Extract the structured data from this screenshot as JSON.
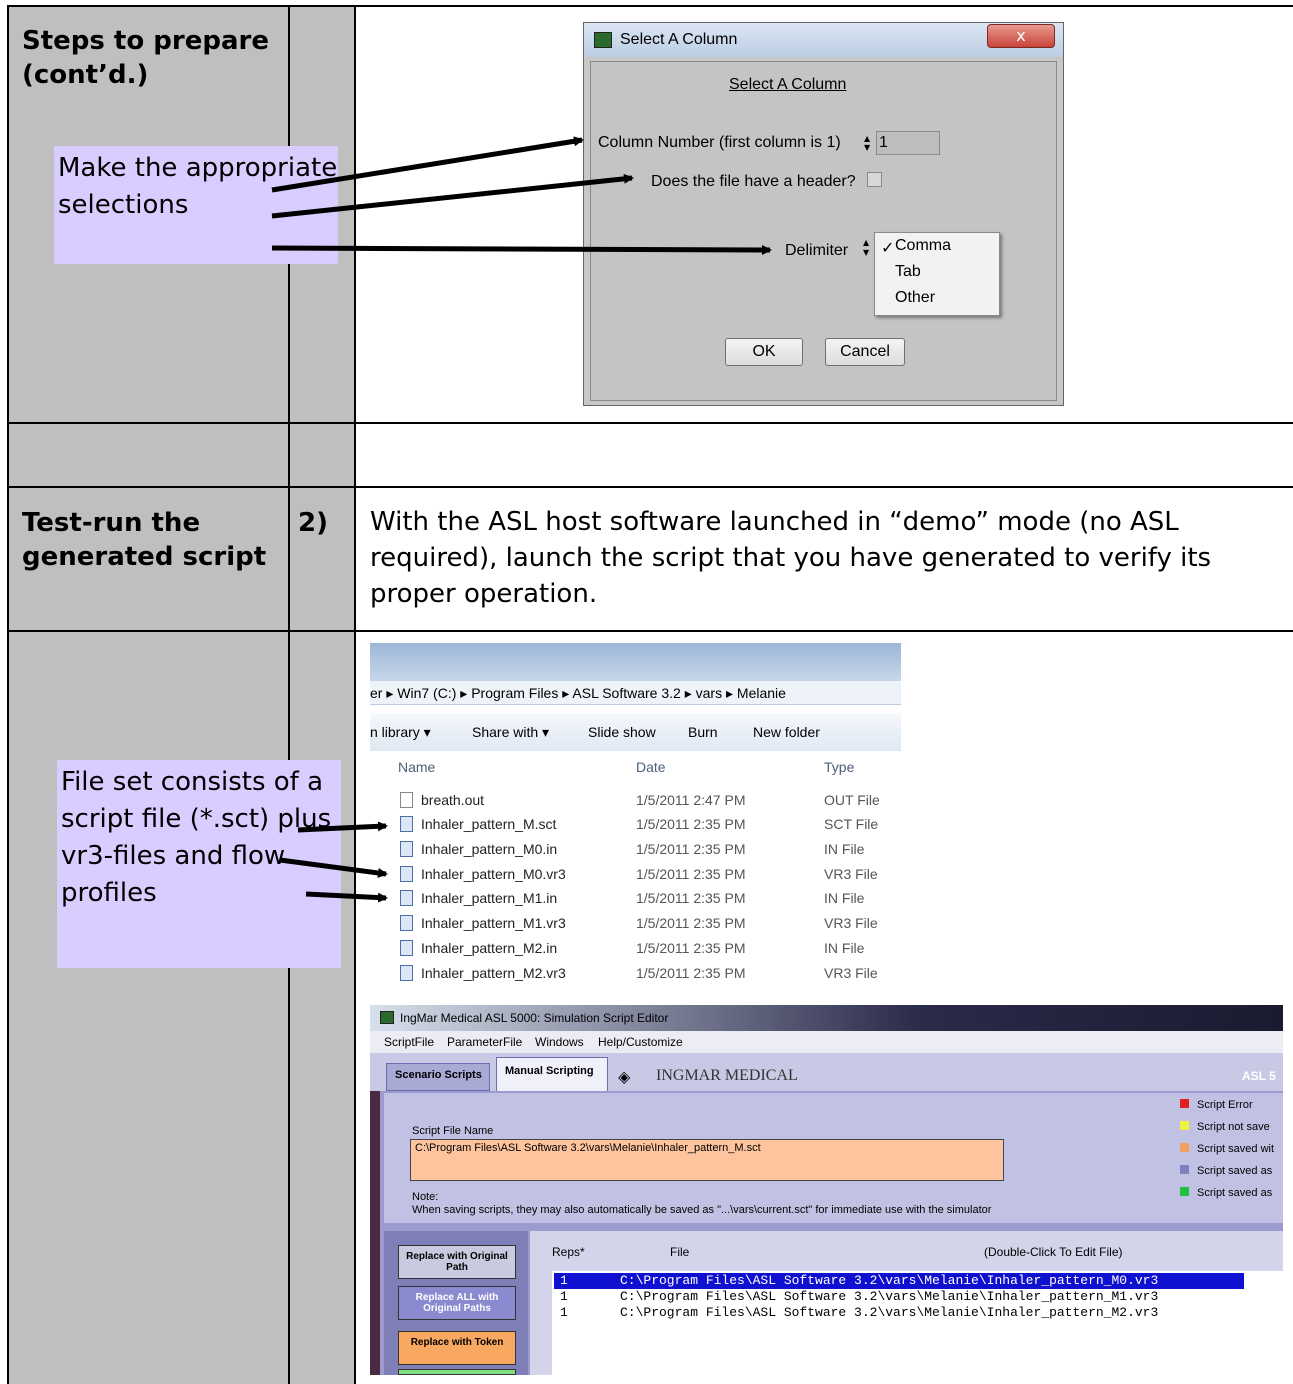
{
  "row1": {
    "heading": "Steps to prepare (cont’d.)",
    "callout": "Make the appropriate selections"
  },
  "dialog": {
    "title": "Select A Column",
    "header": "Select A Column",
    "column_label": "Column Number (first column is 1)",
    "column_value": "1",
    "header_question": "Does the file have a header?",
    "delimiter_label": "Delimiter",
    "delimiter_options": [
      "Comma",
      "Tab",
      "Other"
    ],
    "selected_mark": "✓",
    "ok": "OK",
    "cancel": "Cancel"
  },
  "row3": {
    "heading": "Test-run the generated script",
    "step": "2)",
    "text": "With the ASL host software launched in “demo” mode (no ASL required), launch the script that you have generated to verify its proper operation."
  },
  "row4": {
    "callout": "File set consists of a script file (*.sct) plus vr3-files and flow profiles"
  },
  "explorer": {
    "breadcrumb": [
      "er",
      "Win7 (C:)",
      "Program Files",
      "ASL Software 3.2",
      "vars",
      "Melanie"
    ],
    "toolbar": [
      "n library ▾",
      "Share with ▾",
      "Slide show",
      "Burn",
      "New folder"
    ],
    "columns": [
      "Name",
      "Date",
      "Type"
    ],
    "files": [
      {
        "name": "breath.out",
        "date": "1/5/2011 2:47 PM",
        "type": "OUT File"
      },
      {
        "name": "Inhaler_pattern_M.sct",
        "date": "1/5/2011 2:35 PM",
        "type": "SCT File"
      },
      {
        "name": "Inhaler_pattern_M0.in",
        "date": "1/5/2011 2:35 PM",
        "type": "IN File"
      },
      {
        "name": "Inhaler_pattern_M0.vr3",
        "date": "1/5/2011 2:35 PM",
        "type": "VR3 File"
      },
      {
        "name": "Inhaler_pattern_M1.in",
        "date": "1/5/2011 2:35 PM",
        "type": "IN File"
      },
      {
        "name": "Inhaler_pattern_M1.vr3",
        "date": "1/5/2011 2:35 PM",
        "type": "VR3 File"
      },
      {
        "name": "Inhaler_pattern_M2.in",
        "date": "1/5/2011 2:35 PM",
        "type": "IN File"
      },
      {
        "name": "Inhaler_pattern_M2.vr3",
        "date": "1/5/2011 2:35 PM",
        "type": "VR3 File"
      }
    ]
  },
  "editor": {
    "title": "IngMar Medical ASL 5000:  Simulation Script Editor",
    "menu": [
      "ScriptFile",
      "ParameterFile",
      "Windows",
      "Help/Customize"
    ],
    "tabs": [
      "Scenario Scripts",
      "Manual Scripting"
    ],
    "brand": "INGMAR MEDICAL",
    "brand_right": "ASL 5",
    "script_name_label": "Script File Name",
    "script_path": "C:\\Program Files\\ASL Software 3.2\\vars\\Melanie\\Inhaler_pattern_M.sct",
    "note_label": "Note:",
    "note_text": "When saving scripts, they may also automatically be saved as  \"...\\vars\\current.sct\" for immediate use with the simulator",
    "legend": [
      {
        "color": "#e02020",
        "text": "Script Error"
      },
      {
        "color": "#f0f040",
        "text": "Script not save"
      },
      {
        "color": "#f0a060",
        "text": "Script saved wit"
      },
      {
        "color": "#8080c0",
        "text": "Script saved as"
      },
      {
        "color": "#20c040",
        "text": "Script saved as"
      }
    ],
    "buttons": [
      "Replace with Original Path",
      "Replace ALL with Original Paths",
      "Replace with Token"
    ],
    "list_headers": [
      "Reps*",
      "File",
      "(Double-Click To Edit File)"
    ],
    "list_rows": [
      {
        "reps": "1",
        "file": "C:\\Program Files\\ASL Software 3.2\\vars\\Melanie\\Inhaler_pattern_M0.vr3"
      },
      {
        "reps": "1",
        "file": "C:\\Program Files\\ASL Software 3.2\\vars\\Melanie\\Inhaler_pattern_M1.vr3"
      },
      {
        "reps": "1",
        "file": "C:\\Program Files\\ASL Software 3.2\\vars\\Melanie\\Inhaler_pattern_M2.vr3"
      }
    ]
  }
}
